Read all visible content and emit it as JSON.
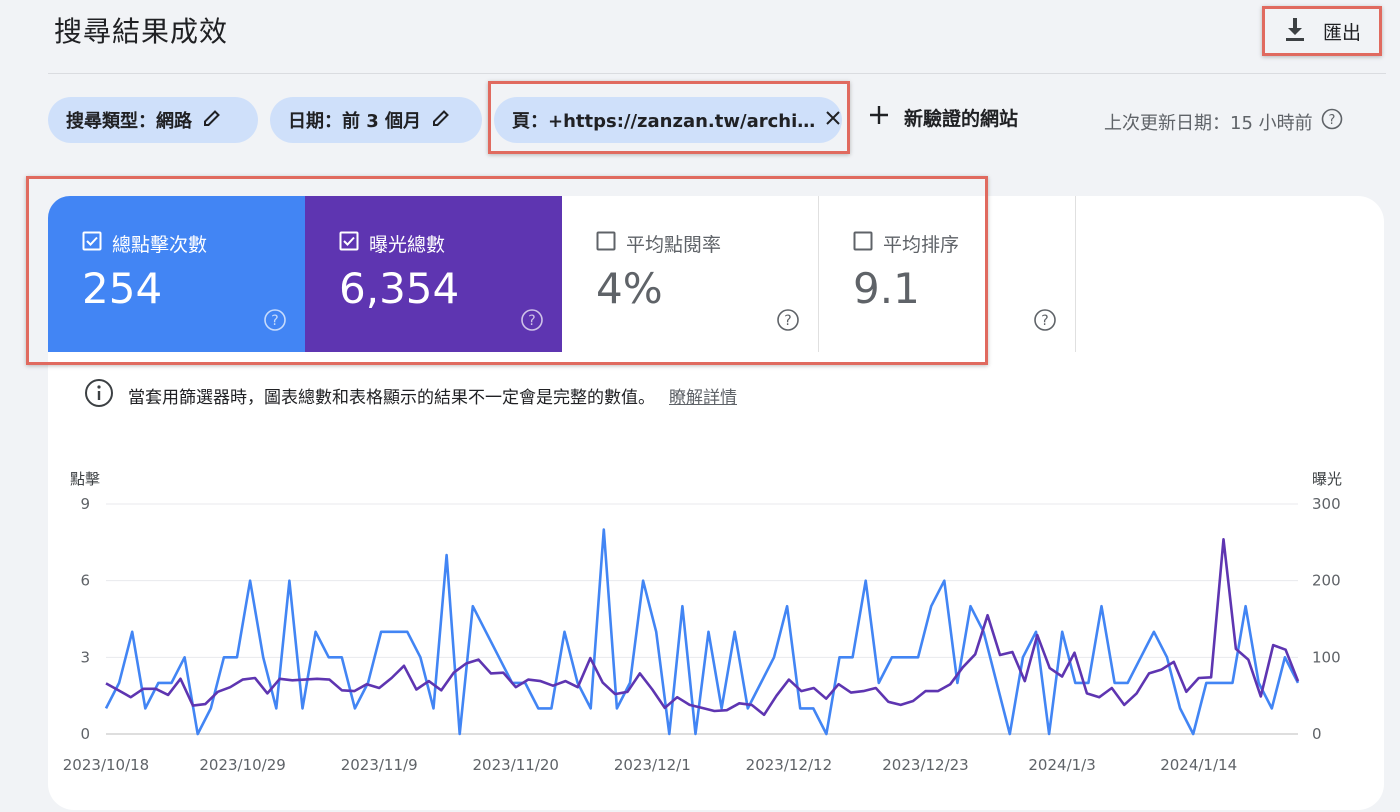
{
  "header": {
    "title": "搜尋結果成效",
    "export_label": "匯出"
  },
  "filters": {
    "search_type": "搜尋類型：網路",
    "date": "日期：前 3 個月",
    "page": "頁：+https://zanzan.tw/archi…",
    "new_site": "新驗證的網站",
    "last_update": "上次更新日期：15 小時前"
  },
  "metrics": [
    {
      "label": "總點擊次數",
      "value": "254",
      "checked": true
    },
    {
      "label": "曝光總數",
      "value": "6,354",
      "checked": true
    },
    {
      "label": "平均點閱率",
      "value": "4%",
      "checked": false
    },
    {
      "label": "平均排序",
      "value": "9.1",
      "checked": false
    }
  ],
  "notice": {
    "text": "當套用篩選器時，圖表總數和表格顯示的結果不一定會是完整的數值。",
    "link": "瞭解詳情"
  },
  "colors": {
    "clicks": "#4285f4",
    "impressions": "#5e35b1",
    "highlight": "#e06a5f"
  },
  "chart_data": {
    "type": "line",
    "ylabel_left": "點擊",
    "ylabel_right": "曝光",
    "y_left_ticks": [
      "0",
      "3",
      "6",
      "9"
    ],
    "y_right_ticks": [
      "0",
      "100",
      "200",
      "300"
    ],
    "ylim_left": [
      0,
      9
    ],
    "ylim_right": [
      0,
      300
    ],
    "x_tick_labels": [
      "2023/10/18",
      "2023/10/29",
      "2023/11/9",
      "2023/11/20",
      "2023/12/1",
      "2023/12/12",
      "2023/12/23",
      "2024/1/3",
      "2024/1/14"
    ],
    "x_start": "2023/10/18",
    "series": [
      {
        "name": "總點擊次數",
        "axis": "left",
        "color": "#4285f4",
        "values": [
          1,
          2,
          4,
          1,
          2,
          2,
          3,
          0,
          1,
          3,
          3,
          6,
          3,
          1,
          6,
          1,
          4,
          3,
          3,
          1,
          2,
          4,
          4,
          4,
          3,
          1,
          7,
          0,
          5,
          4,
          3,
          2,
          2,
          1,
          1,
          4,
          2,
          1,
          8,
          1,
          2,
          6,
          4,
          0,
          5,
          0,
          4,
          1,
          4,
          1,
          2,
          3,
          5,
          1,
          1,
          0,
          3,
          3,
          6,
          2,
          3,
          3,
          3,
          5,
          6,
          2,
          5,
          4,
          2,
          0,
          3,
          4,
          0,
          4,
          2,
          2,
          5,
          2,
          2,
          3,
          4,
          3,
          1,
          0,
          2,
          2,
          2,
          5,
          2,
          1,
          3,
          2
        ]
      },
      {
        "name": "曝光總數",
        "axis": "right",
        "color": "#5e35b1",
        "values": [
          66,
          57,
          48,
          59,
          59,
          51,
          72,
          37,
          39,
          55,
          61,
          71,
          73,
          53,
          72,
          70,
          71,
          72,
          71,
          57,
          56,
          65,
          60,
          73,
          89,
          58,
          69,
          57,
          80,
          92,
          97,
          79,
          80,
          61,
          71,
          69,
          63,
          69,
          61,
          99,
          67,
          52,
          55,
          79,
          58,
          34,
          48,
          38,
          34,
          30,
          31,
          40,
          38,
          25,
          50,
          71,
          56,
          60,
          46,
          65,
          54,
          56,
          60,
          42,
          38,
          43,
          56,
          56,
          65,
          87,
          104,
          155,
          103,
          107,
          69,
          129,
          86,
          75,
          106,
          53,
          48,
          60,
          38,
          53,
          79,
          84,
          94,
          55,
          73,
          74,
          254,
          111,
          97,
          49,
          116,
          110,
          69
        ]
      }
    ]
  }
}
